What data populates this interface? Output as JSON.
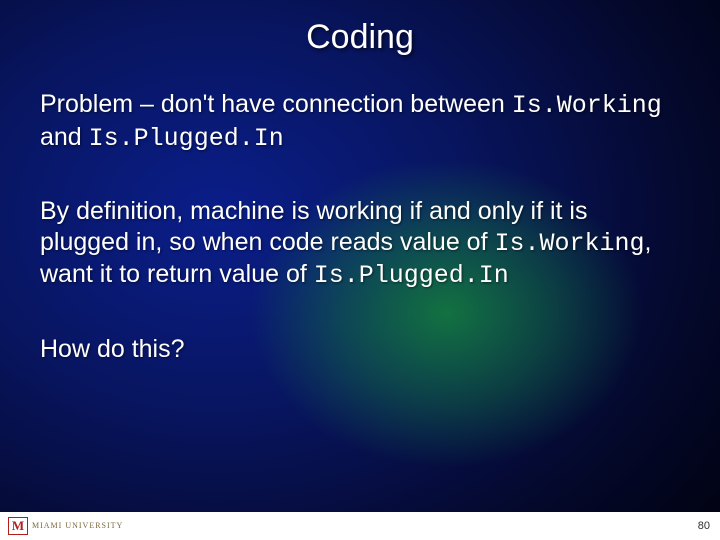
{
  "title": "Coding",
  "para1_a": "Problem – don't have connection between ",
  "para1_code1": "Is.Working",
  "para1_b": " and ",
  "para1_code2": "Is.Plugged.In",
  "para2_a": "By definition, machine is working if and only if it is plugged in, so when code reads value of ",
  "para2_code1": "Is.Working",
  "para2_b": ", want it to return value of ",
  "para2_code2": "Is.Plugged.In",
  "para3": "How do this?",
  "logo_mark": "M",
  "logo_text": "MIAMI UNIVERSITY",
  "page_number": "80"
}
